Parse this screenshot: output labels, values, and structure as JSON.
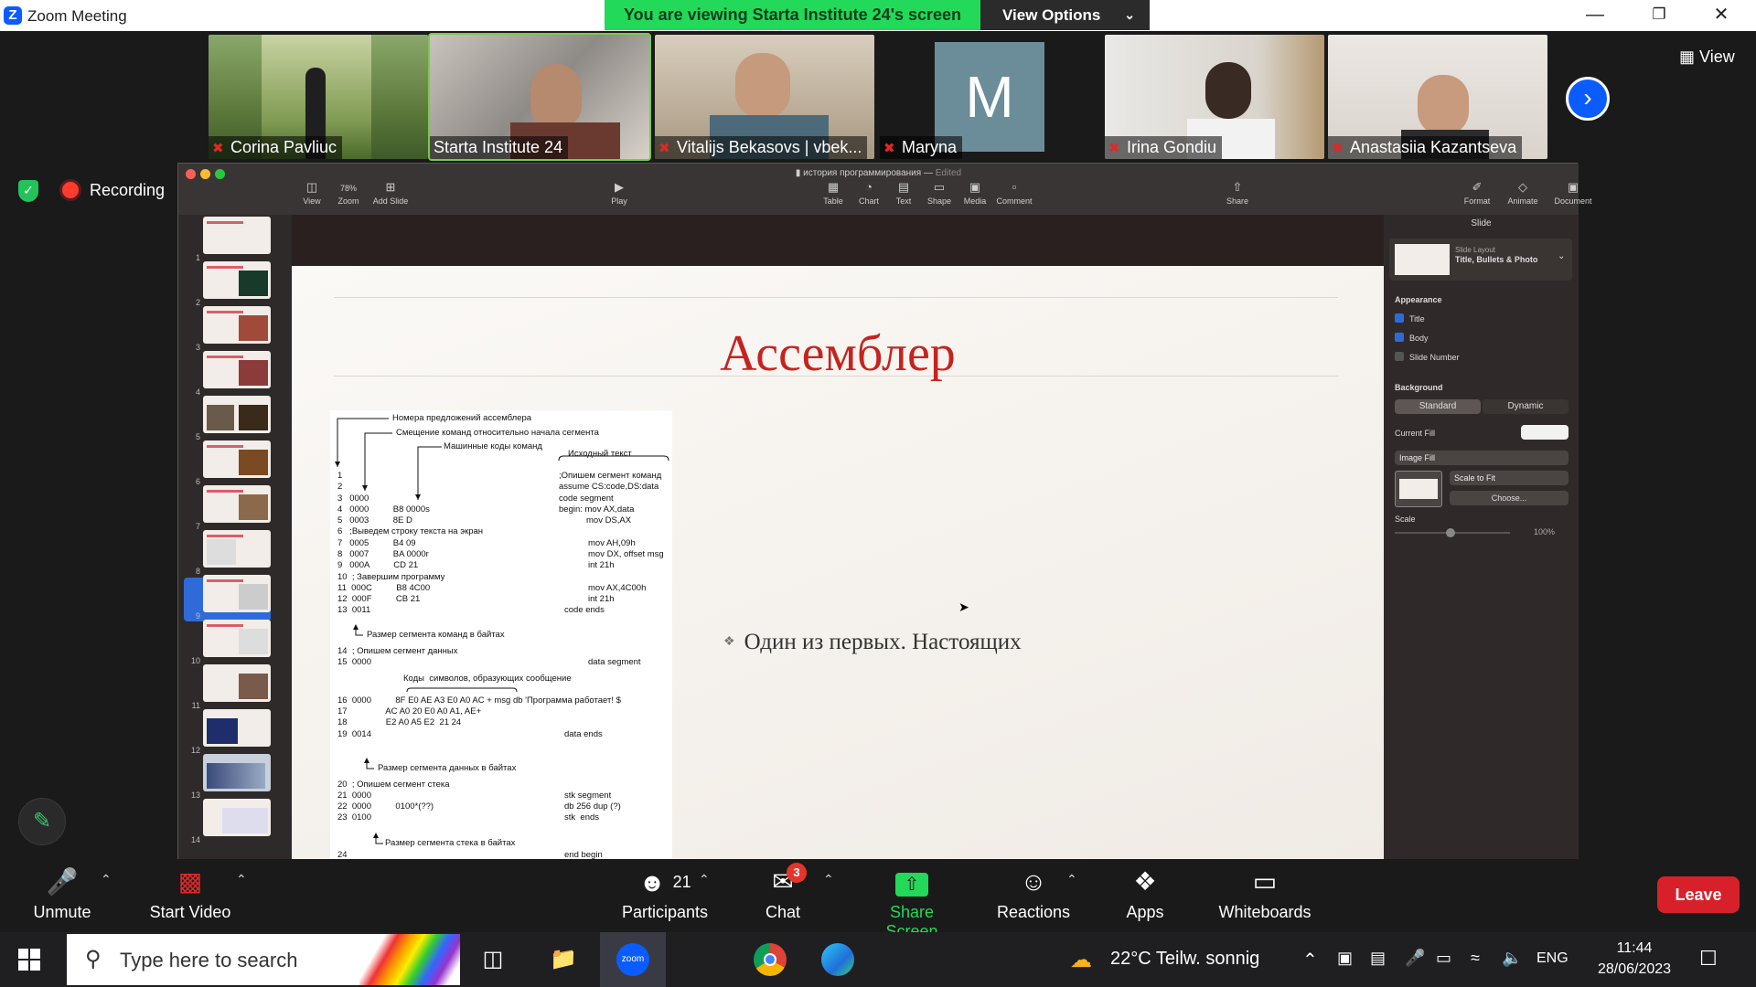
{
  "window": {
    "app_title": "Zoom Meeting",
    "share_banner": "You are viewing Starta Institute 24's screen",
    "view_options_label": "View Options"
  },
  "gallery": {
    "participants": [
      {
        "name": "Corina Pavliuc",
        "muted": true
      },
      {
        "name": "Starta Institute 24",
        "muted": false
      },
      {
        "name": "Vitalijs Bekasovs | vbek...",
        "muted": true
      },
      {
        "name": "Maryna",
        "muted": true,
        "avatar_letter": "M"
      },
      {
        "name": "Irina Gondiu",
        "muted": true
      },
      {
        "name": "Anastasiia Kazantseva",
        "muted": true
      }
    ],
    "view_label": "View"
  },
  "status": {
    "recording_label": "Recording"
  },
  "keynote": {
    "doc_title": "история программирования",
    "doc_status": "Edited",
    "toolbar": {
      "view": "View",
      "zoom": "Zoom",
      "zoom_value": "78%",
      "add_slide": "Add Slide",
      "play": "Play",
      "table": "Table",
      "chart": "Chart",
      "text": "Text",
      "shape": "Shape",
      "media": "Media",
      "comment": "Comment",
      "share": "Share",
      "format": "Format",
      "animate": "Animate",
      "document": "Document"
    },
    "slide_numbers": [
      "1",
      "2",
      "3",
      "4",
      "5",
      "6",
      "7",
      "8",
      "9",
      "10",
      "11",
      "12",
      "13",
      "14"
    ],
    "selected_slide": 8,
    "slide": {
      "title": "Ассемблер",
      "bullet": "Один из первых. Настоящих",
      "asm_lines": [
        "Номера предложений ассемблера",
        "Смещение команд относительно начала сегмента",
        "Машинные коды команд",
        "Исходный текст",
        "1",
        ";Опишем сегмент команд",
        "2",
        "assume CS:code,DS:data",
        "3   0000",
        "code segment",
        "4   0000          B8 0000s",
        "begin: mov AX,data",
        "5   0003          8E D",
        "mov DS,AX",
        "6   ;Выведем строку текста на экран",
        "7   0005          B4 09",
        "mov AH,09h",
        "8   0007          BA 0000r",
        "mov DX, offset msg",
        "9   000A          CD 21",
        "int 21h",
        "10  ; Завершим программу",
        "11  000C          B8 4C00",
        "mov AX,4C00h",
        "12  000F          CB 21",
        "int 21h",
        "13  0011",
        "code ends",
        "Размер сегмента команд в байтах",
        "14  ; Опишем сегмент данных",
        "15  0000",
        "data segment",
        "Коды  символов, образующих сообщение",
        "16  0000          8F E0 AE A3 E0 A0 AC + msg db 'Программа работает! $",
        "17                AC A0 20 E0 A0 A1, AE+",
        "18                E2 A0 A5 E2  21 24",
        "19  0014",
        "data ends",
        "Размер сегмента данных в байтах",
        "20  ; Опишем сегмент стека",
        "21  0000",
        "stk segment",
        "22  0000          0100*(??)",
        "db 256 dup (?)",
        "23  0100",
        "stk  ends",
        "Размер сегмента стека в байтах",
        "24",
        "end begin"
      ]
    },
    "inspector": {
      "header": "Slide",
      "layout_label": "Slide Layout",
      "layout_name": "Title, Bullets & Photo",
      "appearance": "Appearance",
      "title_check": "Title",
      "body_check": "Body",
      "slide_number_check": "Slide Number",
      "background": "Background",
      "standard": "Standard",
      "dynamic": "Dynamic",
      "current_fill": "Current Fill",
      "image_fill": "Image Fill",
      "scale_to_fit": "Scale to Fit",
      "choose": "Choose...",
      "scale": "Scale",
      "scale_value": "100%"
    }
  },
  "toolbar": {
    "unmute": "Unmute",
    "start_video": "Start Video",
    "participants": "Participants",
    "participants_count": "21",
    "chat": "Chat",
    "chat_badge": "3",
    "share_screen": "Share Screen",
    "reactions": "Reactions",
    "apps": "Apps",
    "whiteboards": "Whiteboards",
    "leave": "Leave"
  },
  "taskbar": {
    "search_placeholder": "Type here to search",
    "weather": "22°C  Teilw. sonnig",
    "lang": "ENG",
    "time": "11:44",
    "date": "28/06/2023"
  },
  "colors": {
    "zoom_blue": "#0b5cff",
    "banner_green": "#23d959",
    "leave_red": "#d8202b",
    "slide_title_red": "#c4241f"
  }
}
